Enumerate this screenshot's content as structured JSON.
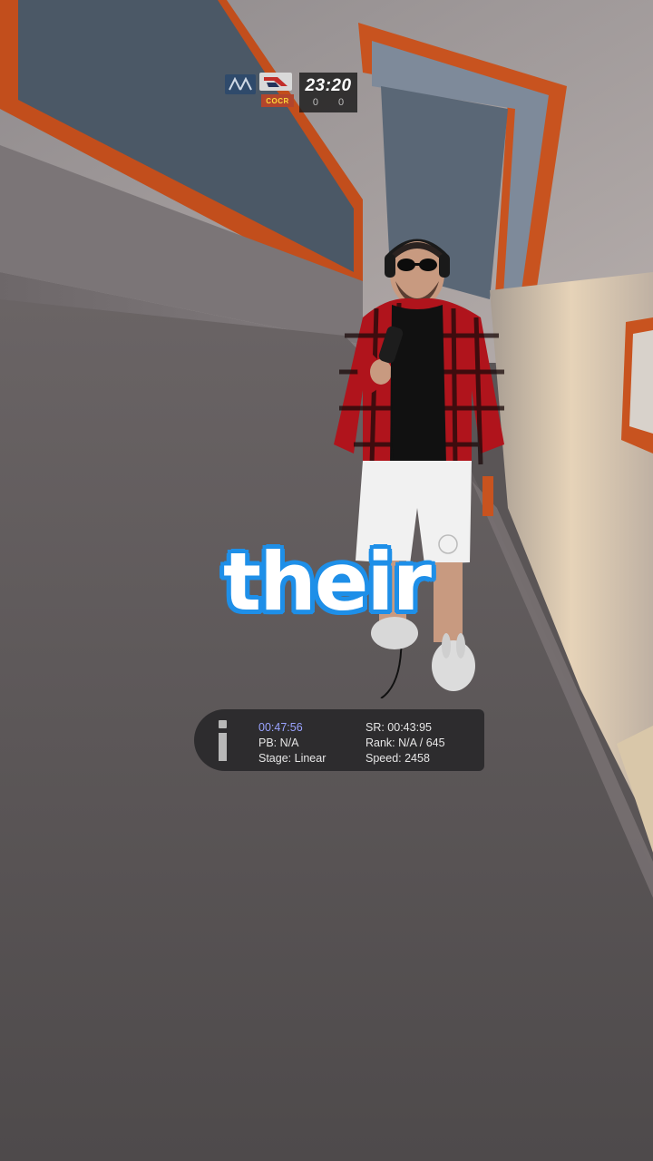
{
  "top_hud": {
    "timer": "23:20",
    "team_tag": "COCR",
    "score_left": "0",
    "score_right": "0"
  },
  "caption": "their",
  "run_hud": {
    "current_time": "00:47:56",
    "pb": "PB: N/A",
    "stage": "Stage: Linear",
    "sr": "SR: 00:43:95",
    "rank": "Rank: N/A / 645",
    "speed": "Speed: 2458"
  },
  "colors": {
    "caption_outline": "#1e8fe8",
    "accent_orange": "#c8531f",
    "shirt_red": "#b0141c"
  }
}
